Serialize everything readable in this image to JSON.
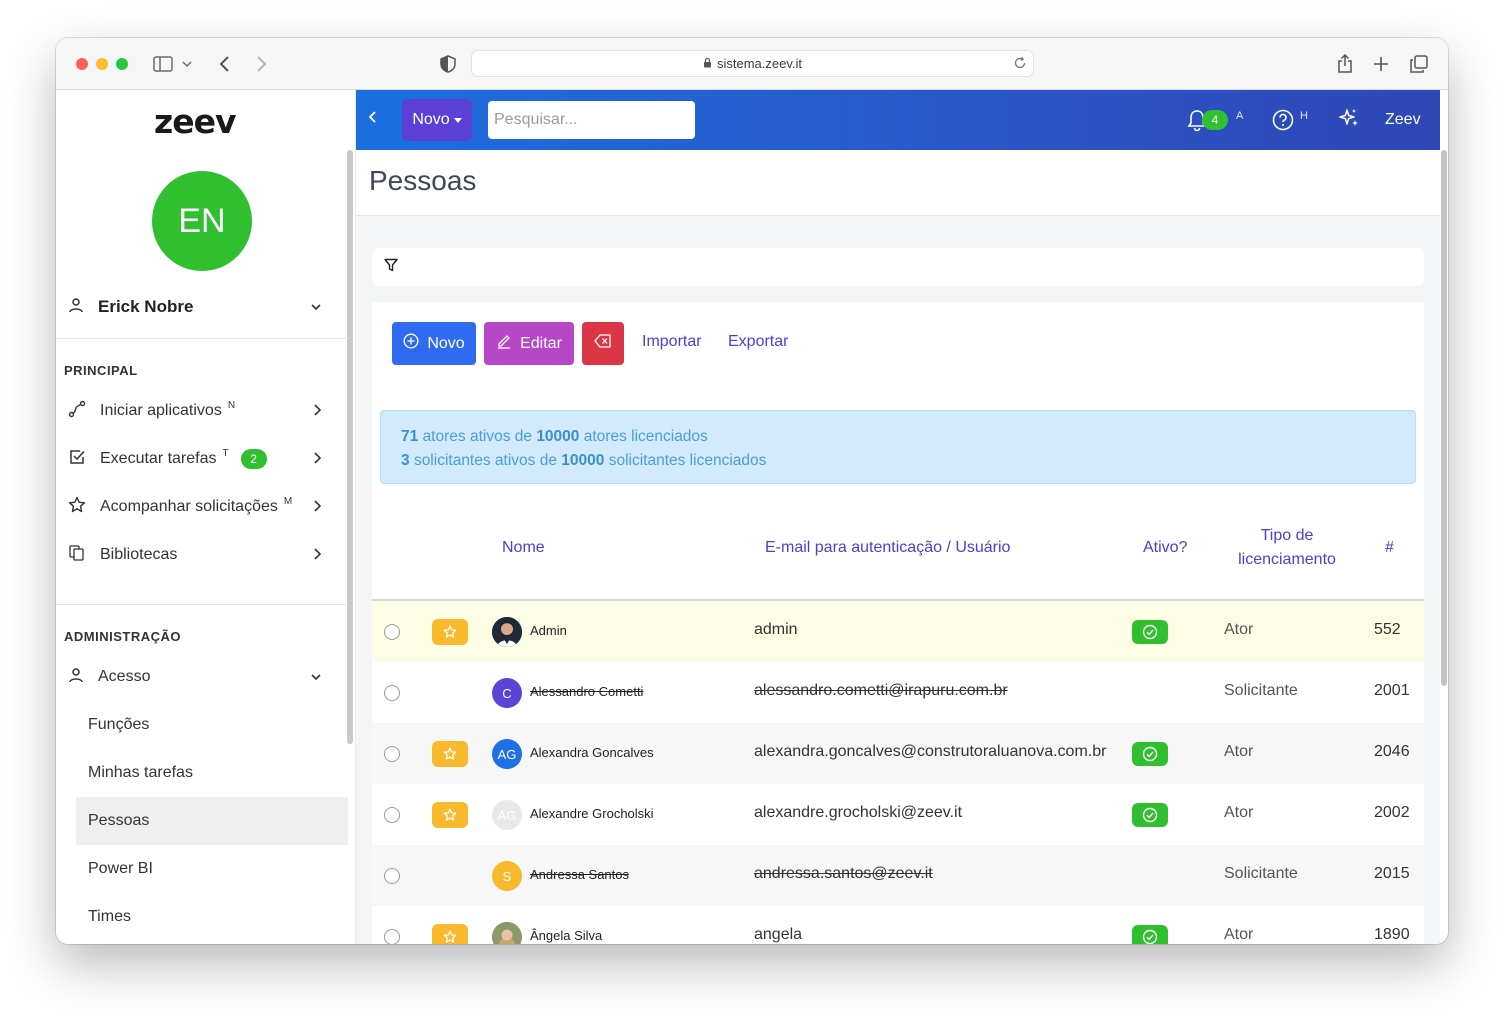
{
  "browser": {
    "url": "sistema.zeev.it"
  },
  "sidebar": {
    "logo": "zeev",
    "avatar_initials": "EN",
    "user_name": "Erick Nobre",
    "principal_title": "PRINCIPAL",
    "principal_items": [
      {
        "label": "Iniciar aplicativos",
        "shortcut": "N",
        "icon": "route-icon"
      },
      {
        "label": "Executar tarefas",
        "shortcut": "T",
        "badge": "2",
        "icon": "checkbox-icon"
      },
      {
        "label": "Acompanhar solicitações",
        "shortcut": "M",
        "icon": "star-icon"
      },
      {
        "label": "Bibliotecas",
        "icon": "library-icon"
      }
    ],
    "admin_title": "ADMINISTRAÇÃO",
    "admin_group": {
      "label": "Acesso",
      "icon": "user-icon"
    },
    "admin_items": [
      "Funções",
      "Minhas tarefas",
      "Pessoas",
      "Power BI",
      "Times"
    ],
    "active_item": "Pessoas"
  },
  "topbar": {
    "novo_label": "Novo",
    "search_placeholder": "Pesquisar...",
    "notif_count": "4",
    "notif_shortcut": "A",
    "help_shortcut": "H",
    "brand": "Zeev",
    "accent_from": "#1b6fe0",
    "accent_to": "#2e47b6"
  },
  "page": {
    "title": "Pessoas"
  },
  "toolbar": {
    "novo_label": "Novo",
    "editar_label": "Editar",
    "importar_label": "Importar",
    "exportar_label": "Exportar"
  },
  "alert": {
    "line1": {
      "n": "71",
      "a": "atores ativos de",
      "m": "10000",
      "b": "atores licenciados"
    },
    "line2": {
      "n": "3",
      "a": "solicitantes ativos de",
      "m": "10000",
      "b": "solicitantes licenciados"
    }
  },
  "table": {
    "headers": {
      "nome": "Nome",
      "email": "E-mail para autenticação / Usuário",
      "ativo": "Ativo?",
      "tipo_line1": "Tipo de",
      "tipo_line2": "licenciamento",
      "num": "#"
    },
    "rows": [
      {
        "name": "Admin",
        "avatar": "",
        "avatar_color": "#1e2a3a",
        "email": "admin",
        "starred": true,
        "active": true,
        "tipo": "Ator",
        "id": "552",
        "inactive": false
      },
      {
        "name": "Alessandro Cometti",
        "avatar": "C",
        "avatar_color": "#5b45d8",
        "email": "alessandro.cometti@irapuru.com.br",
        "starred": false,
        "active": false,
        "tipo": "Solicitante",
        "id": "2001",
        "inactive": true
      },
      {
        "name": "Alexandra Goncalves",
        "avatar": "AG",
        "avatar_color": "#1f6fe5",
        "email": "alexandra.goncalves@construtoraluanova.com.br",
        "starred": true,
        "active": true,
        "tipo": "Ator",
        "id": "2046",
        "inactive": false
      },
      {
        "name": "Alexandre Grocholski",
        "avatar": "AG",
        "avatar_color": "#e9e9e9",
        "email": "alexandre.grocholski@zeev.it",
        "starred": true,
        "active": true,
        "tipo": "Ator",
        "id": "2002",
        "inactive": false
      },
      {
        "name": "Andressa Santos",
        "avatar": "S",
        "avatar_color": "#f9b92c",
        "email": "andressa.santos@zeev.it",
        "starred": false,
        "active": false,
        "tipo": "Solicitante",
        "id": "2015",
        "inactive": true
      },
      {
        "name": "Ângela Silva",
        "avatar": "",
        "avatar_color": "#b08a6a",
        "email": "angela",
        "starred": true,
        "active": true,
        "tipo": "Ator",
        "id": "1890",
        "inactive": false
      }
    ]
  }
}
